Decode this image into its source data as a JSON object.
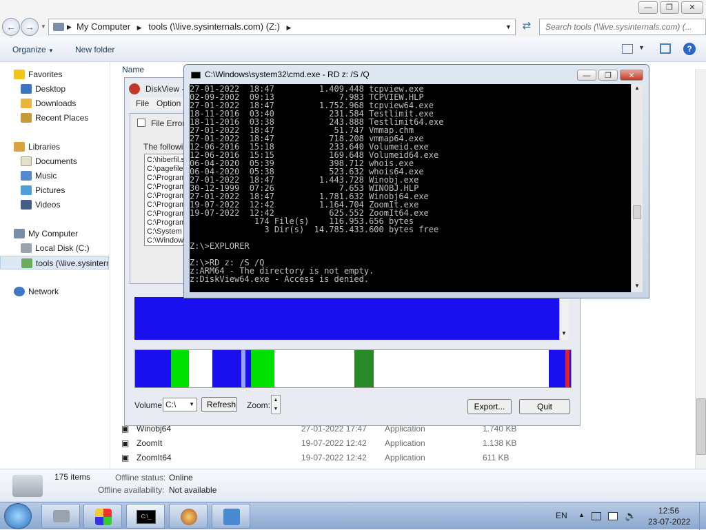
{
  "colors": {
    "cmd_bg": "#000000",
    "cmd_fg": "#c0c0c0",
    "diskmap_blue": "#1a10ee",
    "diskmap_green": "#00e000",
    "taskbar": "#9cb6d8",
    "accent": "#2a5ea8"
  },
  "explorer": {
    "breadcrumb": {
      "root": "My Computer",
      "current": "tools (\\\\live.sysinternals.com) (Z:)"
    },
    "search_placeholder": "Search tools (\\\\live.sysinternals.com) (...",
    "toolbar": {
      "organize": "Organize",
      "new_folder": "New folder"
    },
    "column_name": "Name",
    "nav": {
      "favorites": "Favorites",
      "desktop": "Desktop",
      "downloads": "Downloads",
      "recent_places": "Recent Places",
      "libraries": "Libraries",
      "documents": "Documents",
      "music": "Music",
      "pictures": "Pictures",
      "videos": "Videos",
      "my_computer": "My Computer",
      "local_disk": "Local Disk (C:)",
      "tools_drive": "tools (\\\\live.sysinterna",
      "network": "Network"
    },
    "files": [
      {
        "name": "Winobj64",
        "date": "27-01-2022 17:47",
        "type": "Application",
        "size": "1.740 KB"
      },
      {
        "name": "ZoomIt",
        "date": "19-07-2022 12:42",
        "type": "Application",
        "size": "1.138 KB"
      },
      {
        "name": "ZoomIt64",
        "date": "19-07-2022 12:42",
        "type": "Application",
        "size": "611 KB"
      }
    ],
    "status": {
      "items": "175 items",
      "offline_status_label": "Offline status:",
      "offline_status_value": "Online",
      "offline_avail_label": "Offline availability:",
      "offline_avail_value": "Not available"
    }
  },
  "diskview": {
    "title": "DiskView -",
    "menu": {
      "file": "File",
      "options": "Option"
    },
    "file_error": {
      "title": "File Error",
      "intro": "The followin",
      "paths": [
        "C:\\hiberfil.s",
        "C:\\pagefile.",
        "C:\\Program",
        "C:\\Program",
        "C:\\Program",
        "C:\\Program",
        "C:\\Program",
        "C:\\Program",
        "C:\\System V",
        "C:\\Window"
      ]
    },
    "volume_label": "Volume:",
    "volume_value": "C:\\",
    "refresh": "Refresh",
    "zoom_label": "Zoom:",
    "export": "Export...",
    "quit": "Quit"
  },
  "cmd": {
    "title": "C:\\Windows\\system32\\cmd.exe - RD  z: /S /Q",
    "lines": [
      "27-01-2022  18:47         1.409.448 tcpview.exe",
      "02-09-2002  09:13             7.983 TCPVIEW.HLP",
      "27-01-2022  18:47         1.752.968 tcpview64.exe",
      "18-11-2016  03:40           231.584 Testlimit.exe",
      "18-11-2016  03:38           243.888 Testlimit64.exe",
      "27-01-2022  18:47            51.747 Vmmap.chm",
      "27-01-2022  18:47           718.208 vmmap64.exe",
      "12-06-2016  15:18           233.640 Volumeid.exe",
      "12-06-2016  15:15           169.648 Volumeid64.exe",
      "06-04-2020  05:39           398.712 whois.exe",
      "06-04-2020  05:38           523.632 whois64.exe",
      "27-01-2022  18:47         1.443.728 Winobj.exe",
      "30-12-1999  07:26             7.653 WINOBJ.HLP",
      "27-01-2022  18:47         1.781.632 Winobj64.exe",
      "19-07-2022  12:42         1.164.704 ZoomIt.exe",
      "19-07-2022  12:42           625.552 ZoomIt64.exe",
      "             174 File(s)    116.953.656 bytes",
      "               3 Dir(s)  14.785.433.600 bytes free",
      "",
      "Z:\\>EXPLORER",
      "",
      "Z:\\>RD z: /S /Q",
      "z:ARM64 - The directory is not empty.",
      "z:DiskView64.exe - Access is denied."
    ]
  },
  "taskbar": {
    "lang": "EN",
    "time": "12:56",
    "date": "23-07-2022"
  }
}
